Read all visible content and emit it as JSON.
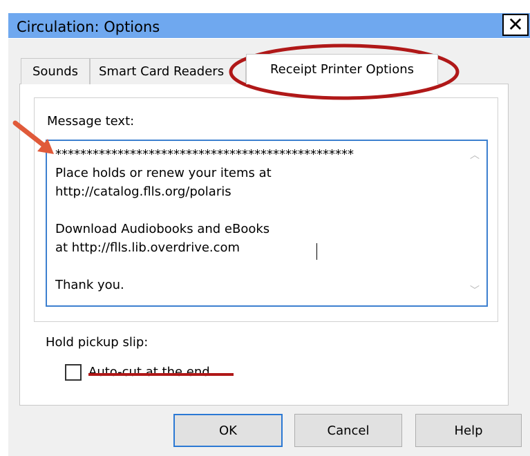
{
  "window": {
    "title": "Circulation: Options",
    "close_glyph": "✕"
  },
  "tabs": [
    {
      "label": "Sounds",
      "active": false
    },
    {
      "label": "Smart Card Readers",
      "active": false
    },
    {
      "label": "Receipt Printer Options",
      "active": true
    }
  ],
  "receipt_printer": {
    "message_label": "Message text:",
    "message_text": "************************************************\nPlace holds or renew your items at\nhttp://catalog.flls.org/polaris\n\nDownload Audiobooks and eBooks\nat http://flls.lib.overdrive.com\n\nThank you.",
    "hold_pickup_label": "Hold pickup slip:",
    "autocut_label": "Auto-cut at the end",
    "autocut_checked": false
  },
  "buttons": {
    "ok": "OK",
    "cancel": "Cancel",
    "help": "Help"
  },
  "annotations": {
    "circle_color": "#b01818",
    "arrow_color": "#e05a3a",
    "strike_color": "#b01818"
  },
  "colors": {
    "titlebar": "#6fa8ef",
    "focus_border": "#3c7fcf",
    "default_button_border": "#2b78d4"
  }
}
